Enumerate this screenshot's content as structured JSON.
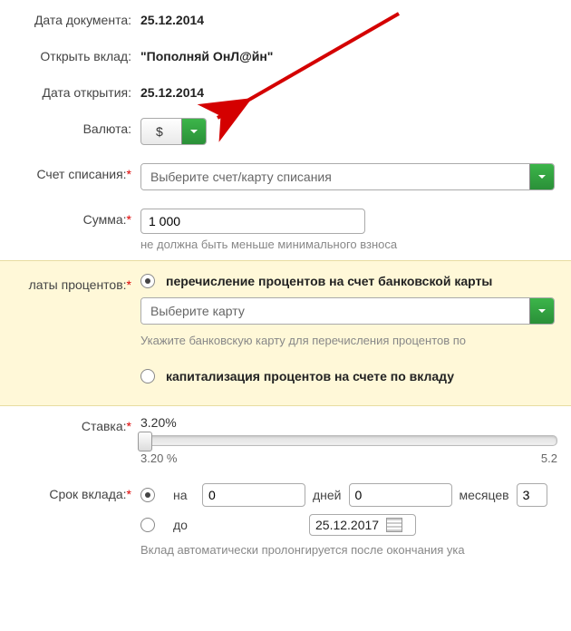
{
  "labels": {
    "doc_date": "Дата документа:",
    "open_deposit": "Открыть вклад:",
    "open_date": "Дата открытия:",
    "currency": "Валюта:",
    "debit_account": "Счет списания:",
    "amount": "Сумма:",
    "interest": "латы процентов:",
    "rate": "Ставка:",
    "term": "Срок вклада:"
  },
  "values": {
    "doc_date": "25.12.2014",
    "deposit_name": "\"Пополняй ОнЛ@йн\"",
    "open_date": "25.12.2014",
    "currency": "$",
    "debit_placeholder": "Выберите счет/карту списания",
    "amount": "1 000",
    "amount_hint": "не должна быть меньше минимального взноса",
    "interest_opt_transfer": "перечисление процентов на счет банковской карты",
    "card_placeholder": "Выберите карту",
    "card_hint": "Укажите банковскую карту для перечисления процентов по",
    "interest_opt_capitalize": "капитализация процентов на счете по вкладу",
    "rate": "3.20%",
    "rate_min": "3.20 %",
    "rate_max": "5.2",
    "term_for": "на",
    "term_days_val": "0",
    "term_days_lbl": "дней",
    "term_months_val": "0",
    "term_months_lbl": "месяцев",
    "term_years_val": "3",
    "term_until": "до",
    "term_until_date": "25.12.2017",
    "term_hint": "Вклад автоматически пролонгируется после окончания ука"
  }
}
